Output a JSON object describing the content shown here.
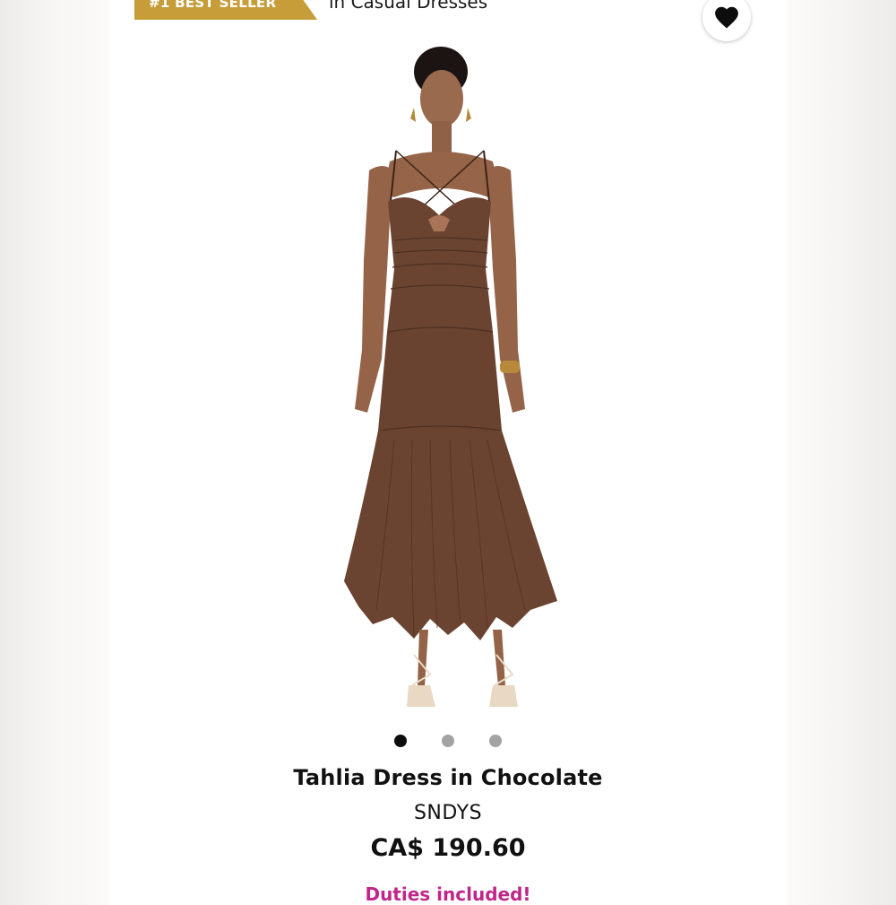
{
  "badge": {
    "label": "#1 BEST SELLER",
    "color": "#c79d3a"
  },
  "category": {
    "text": "in Casual Dresses"
  },
  "favorite": {
    "icon": "heart-icon"
  },
  "product": {
    "title": "Tahlia Dress in Chocolate",
    "brand": "SNDYS",
    "price": "CA$ 190.60",
    "duties_note": "Duties included!",
    "dress_color": "#6b4431"
  },
  "carousel": {
    "total": 3,
    "active_index": 0
  },
  "colors": {
    "accent_pink": "#c0268a",
    "text": "#111111"
  }
}
